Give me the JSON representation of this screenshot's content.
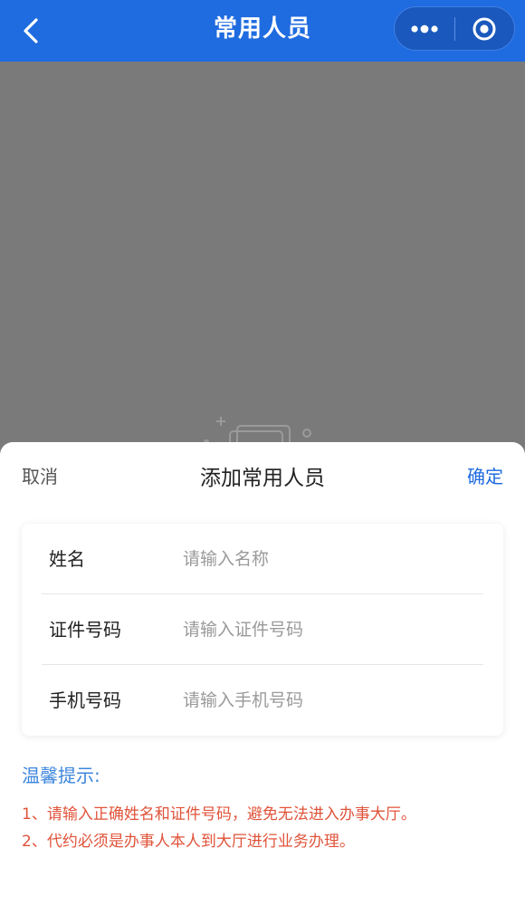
{
  "navbar": {
    "title": "常用人员",
    "back_icon": "chevron-left-icon",
    "more_icon": "more-dots-icon",
    "close_icon": "target-circle-icon",
    "bg_color": "#1f6be0"
  },
  "sheet": {
    "cancel_label": "取消",
    "title": "添加常用人员",
    "confirm_label": "确定"
  },
  "form": {
    "fields": [
      {
        "label": "姓名",
        "placeholder": "请输入名称",
        "value": ""
      },
      {
        "label": "证件号码",
        "placeholder": "请输入证件号码",
        "value": ""
      },
      {
        "label": "手机号码",
        "placeholder": "请输入手机号码",
        "value": ""
      }
    ]
  },
  "tips": {
    "title": "温馨提示:",
    "lines": [
      "1、请输入正确姓名和证件号码，避免无法进入办事大厅。",
      "2、代约必须是办事人本人到大厅进行业务办理。"
    ]
  },
  "colors": {
    "accent": "#1f6be0",
    "tip_title": "#3d86dc",
    "warning": "#e0533a",
    "overlay": "#7a7a7a"
  }
}
